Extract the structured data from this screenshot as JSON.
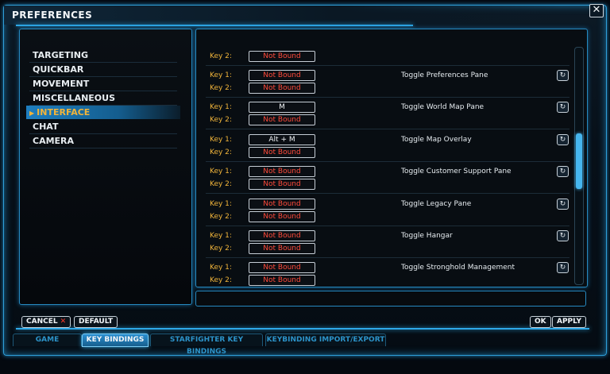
{
  "window": {
    "title": "PREFERENCES",
    "close_glyph": "✕"
  },
  "categories": [
    {
      "label": "TARGETING",
      "active": false
    },
    {
      "label": "QUICKBAR",
      "active": false
    },
    {
      "label": "MOVEMENT",
      "active": false
    },
    {
      "label": "MISCELLANEOUS",
      "active": false
    },
    {
      "label": "INTERFACE",
      "active": true
    },
    {
      "label": "CHAT",
      "active": false
    },
    {
      "label": "CAMERA",
      "active": false
    }
  ],
  "bindings": {
    "partial_row": {
      "key2_label": "Key 2:",
      "key2_value": "Not Bound"
    },
    "rows": [
      {
        "key1_label": "Key 1:",
        "key1_value": "Not Bound",
        "key2_label": "Key 2:",
        "key2_value": "Not Bound",
        "action": "Toggle Preferences Pane"
      },
      {
        "key1_label": "Key 1:",
        "key1_value": "M",
        "key2_label": "Key 2:",
        "key2_value": "Not Bound",
        "action": "Toggle World Map Pane"
      },
      {
        "key1_label": "Key 1:",
        "key1_value": "Alt + M",
        "key2_label": "Key 2:",
        "key2_value": "Not Bound",
        "action": "Toggle Map Overlay"
      },
      {
        "key1_label": "Key 1:",
        "key1_value": "Not Bound",
        "key2_label": "Key 2:",
        "key2_value": "Not Bound",
        "action": "Toggle Customer Support Pane"
      },
      {
        "key1_label": "Key 1:",
        "key1_value": "Not Bound",
        "key2_label": "Key 2:",
        "key2_value": "Not Bound",
        "action": "Toggle Legacy Pane"
      },
      {
        "key1_label": "Key 1:",
        "key1_value": "Not Bound",
        "key2_label": "Key 2:",
        "key2_value": "Not Bound",
        "action": "Toggle Hangar"
      },
      {
        "key1_label": "Key 1:",
        "key1_value": "Not Bound",
        "key2_label": "Key 2:",
        "key2_value": "Not Bound",
        "action": "Toggle Stronghold Management"
      }
    ],
    "reset_glyph": "↻",
    "scroll_position_fraction": 0.38
  },
  "footer": {
    "cancel_label": "CANCEL",
    "cancel_glyph": "✕",
    "default_label": "DEFAULT",
    "ok_label": "OK",
    "apply_label": "APPLY"
  },
  "tabs": [
    {
      "label": "GAME",
      "active": false
    },
    {
      "label": "KEY BINDINGS",
      "active": true
    },
    {
      "label": "STARFIGHTER KEY BINDINGS",
      "active": false
    },
    {
      "label": "KEYBINDING IMPORT/EXPORT",
      "active": false
    }
  ],
  "colors": {
    "accent": "#2ea9e8",
    "key_label": "#f0b43a",
    "unbound": "#ff4a3a",
    "active_category": "#f2b43a"
  }
}
